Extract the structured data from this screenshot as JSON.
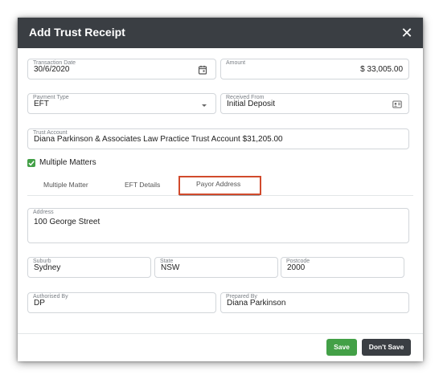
{
  "dialog": {
    "title": "Add Trust Receipt",
    "close_glyph": "✕"
  },
  "fields": {
    "transaction_date": {
      "label": "Transaction Date",
      "value": "30/6/2020"
    },
    "amount": {
      "label": "Amount",
      "value": "$ 33,005.00"
    },
    "payment_type": {
      "label": "Payment Type",
      "value": "EFT"
    },
    "received_from": {
      "label": "Received From",
      "value": "Initial Deposit"
    },
    "trust_account": {
      "label": "Trust Account",
      "value": "Diana Parkinson & Associates Law Practice Trust Account  $31,205.00"
    },
    "address": {
      "label": "Address",
      "value": "100 George Street"
    },
    "suburb": {
      "label": "Suburb",
      "value": "Sydney"
    },
    "state": {
      "label": "State",
      "value": "NSW"
    },
    "postcode": {
      "label": "Postcode",
      "value": "2000"
    },
    "authorised_by": {
      "label": "Authorised By",
      "value": "DP"
    },
    "prepared_by": {
      "label": "Prepared By",
      "value": "Diana Parkinson"
    }
  },
  "multiple_matters": {
    "label": "Multiple Matters",
    "checked": true
  },
  "tabs": [
    {
      "label": "Multiple Matter"
    },
    {
      "label": "EFT Details"
    },
    {
      "label": "Payor Address",
      "active": true
    }
  ],
  "buttons": {
    "save_label": "Save",
    "dont_save_label": "Don't Save"
  },
  "colors": {
    "titlebar": "#3a3e43",
    "save": "#43a047",
    "dont_save": "#3a3e43",
    "highlight": "#d14a2c"
  },
  "icons": {
    "date_icon": "calendar-icon",
    "payment_type_icon": "caret-down-icon",
    "received_from_icon": "contact-card-icon",
    "check_icon": "check-icon"
  }
}
